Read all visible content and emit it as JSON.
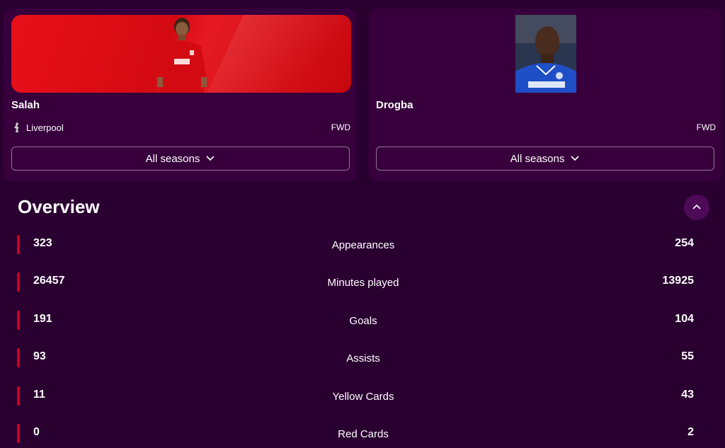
{
  "players": [
    {
      "name": "Salah",
      "club": "Liverpool",
      "position": "FWD",
      "season_filter": "All seasons",
      "banner_color": "#e8101a"
    },
    {
      "name": "Drogba",
      "club": "",
      "position": "FWD",
      "season_filter": "All seasons"
    }
  ],
  "overview": {
    "title": "Overview",
    "stats": [
      {
        "label": "Appearances",
        "left": "323",
        "right": "254"
      },
      {
        "label": "Minutes played",
        "left": "26457",
        "right": "13925"
      },
      {
        "label": "Goals",
        "left": "191",
        "right": "104"
      },
      {
        "label": "Assists",
        "left": "93",
        "right": "55"
      },
      {
        "label": "Yellow Cards",
        "left": "11",
        "right": "43"
      },
      {
        "label": "Red Cards",
        "left": "0",
        "right": "2"
      }
    ]
  },
  "colors": {
    "background": "#2a0031",
    "card": "#37003c",
    "accent_bar": "#d0001e"
  },
  "icons": {
    "club_crest": "liverpool-crest-icon",
    "dropdown": "chevron-down-icon",
    "collapse": "chevron-up-icon"
  }
}
